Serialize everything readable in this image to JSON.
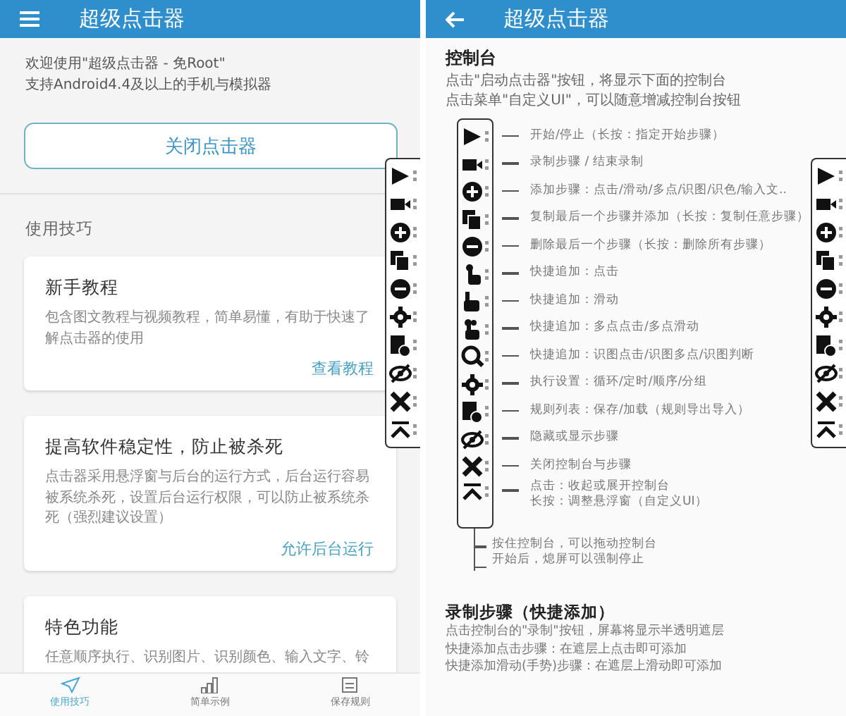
{
  "left": {
    "title": "超级点击器",
    "intro": [
      "欢迎使用\"超级点击器 - 免Root\"",
      "支持Android4.4及以上的手机与模拟器"
    ],
    "close_button": "关闭点击器",
    "section_label": "使用技巧",
    "cards": [
      {
        "title": "新手教程",
        "body": "包含图文教程与视频教程，简单易懂，有助于快速了解点击器的使用",
        "action": "查看教程"
      },
      {
        "title": "提高软件稳定性，防止被杀死",
        "body": "点击器采用悬浮窗与后台的运行方式，后台运行容易被系统杀死，设置后台运行权限，可以防止被系统杀死（强烈建议设置）",
        "action": "允许后台运行"
      },
      {
        "title": "特色功能",
        "body": "任意顺序执行、识别图片、识别颜色、输入文字、铃"
      }
    ],
    "tabs": [
      {
        "label": "使用技巧",
        "selected": true
      },
      {
        "label": "简单示例",
        "selected": false
      },
      {
        "label": "保存规则",
        "selected": false
      }
    ]
  },
  "right": {
    "title": "超级点击器",
    "heading": "控制台",
    "description": [
      "点击\"启动点击器\"按钮，将显示下面的控制台",
      "点击菜单\"自定义UI\"，可以随意增减控制台按钮"
    ],
    "legend": [
      {
        "lines": [
          "开始/停止（长按：指定开始步骤）"
        ]
      },
      {
        "lines": [
          "录制步骤 / 结束录制"
        ]
      },
      {
        "lines": [
          "添加步骤：点击/滑动/多点/识图/识色/输入文.."
        ]
      },
      {
        "lines": [
          "复制最后一个步骤并添加（长按：复制任意步骤）"
        ]
      },
      {
        "lines": [
          "删除最后一个步骤（长按：删除所有步骤）"
        ]
      },
      {
        "lines": [
          "快捷追加：点击"
        ]
      },
      {
        "lines": [
          "快捷追加：滑动"
        ]
      },
      {
        "lines": [
          "快捷追加：多点点击/多点滑动"
        ]
      },
      {
        "lines": [
          "快捷追加：识图点击/识图多点/识图判断"
        ]
      },
      {
        "lines": [
          "执行设置：循环/定时/顺序/分组"
        ]
      },
      {
        "lines": [
          "规则列表：保存/加载（规则导出导入）"
        ]
      },
      {
        "lines": [
          "隐藏或显示步骤"
        ]
      },
      {
        "lines": [
          "关闭控制台与步骤"
        ]
      },
      {
        "lines": [
          "点击：收起或展开控制台",
          "长按：调整悬浮窗（自定义UI）"
        ]
      }
    ],
    "notes": [
      "按住控制台，可以拖动控制台",
      "开始后，熄屏可以强制停止"
    ],
    "section2": {
      "heading": "录制步骤（快捷添加）",
      "lines": [
        "点击控制台的\"录制\"按钮，屏幕将显示半透明遮层",
        "快捷添加点击步骤：在遮层上点击即可添加",
        "快捷添加滑动(手势)步骤：在遮层上滑动即可添加"
      ]
    }
  }
}
